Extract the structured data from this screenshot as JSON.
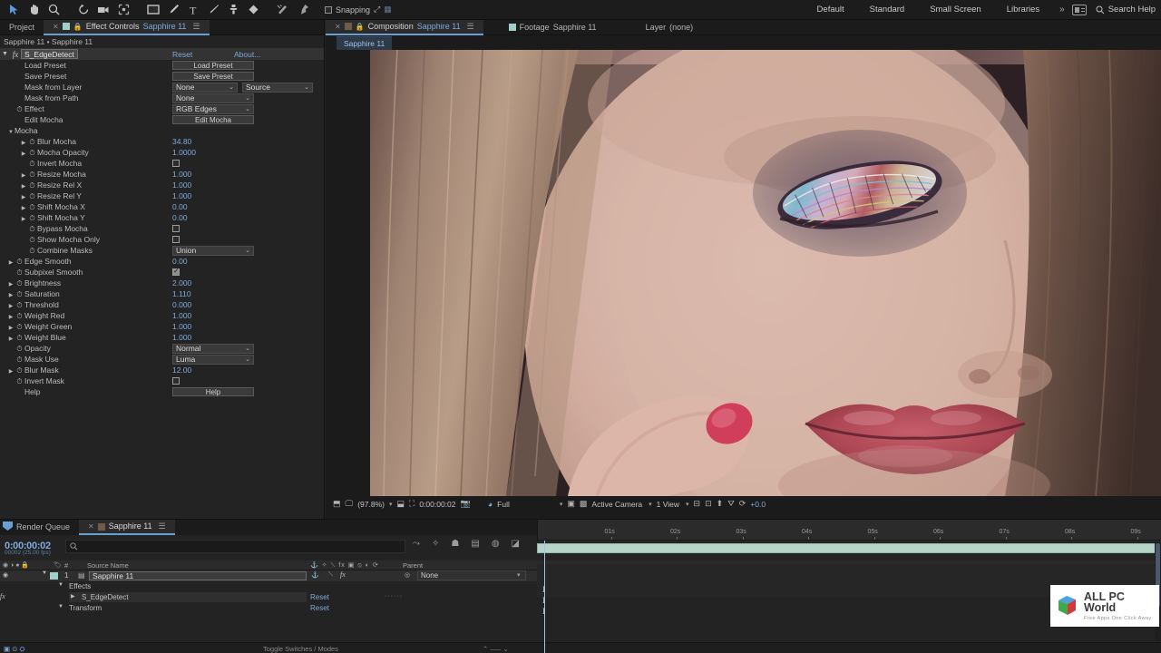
{
  "toolbar": {
    "tools": [
      {
        "name": "selection-tool",
        "glyph": "➤"
      },
      {
        "name": "hand-tool",
        "glyph": "✋"
      },
      {
        "name": "zoom-tool",
        "glyph": "🔍"
      },
      {
        "name": "rotation-tool",
        "glyph": "↺"
      },
      {
        "name": "camera-tool",
        "glyph": "🎥"
      },
      {
        "name": "pan-behind-tool",
        "glyph": "⛶"
      },
      {
        "name": "shape-tool",
        "glyph": "▭"
      },
      {
        "name": "pen-tool",
        "glyph": "✒"
      },
      {
        "name": "type-tool",
        "glyph": "T"
      },
      {
        "name": "brush-tool",
        "glyph": "✏"
      },
      {
        "name": "clone-stamp-tool",
        "glyph": "⚲"
      },
      {
        "name": "eraser-tool",
        "glyph": "◆"
      },
      {
        "name": "roto-brush-tool",
        "glyph": "⫽"
      },
      {
        "name": "puppet-pin-tool",
        "glyph": "📌"
      }
    ],
    "snapping_label": "Snapping",
    "workspaces": [
      "Default",
      "Standard",
      "Small Screen",
      "Libraries"
    ],
    "overflow_glyph": "»",
    "search_help": "Search Help"
  },
  "effect_controls": {
    "tab_project": "Project",
    "tab_title_prefix": "Effect Controls",
    "tab_title_item": "Sapphire 11",
    "breadcrumb": "Sapphire 11 • Sapphire 11",
    "effect_name": "S_EdgeDetect",
    "reset_label": "Reset",
    "about_label": "About...",
    "rows": [
      {
        "label": "Load Preset",
        "type": "button",
        "value": "Load Preset",
        "indent": 0
      },
      {
        "label": "Save Preset",
        "type": "button",
        "value": "Save Preset",
        "indent": 0
      },
      {
        "label": "Mask from Layer",
        "type": "dropdown2",
        "value": "None",
        "value2": "Source",
        "indent": 0
      },
      {
        "label": "Mask from Path",
        "type": "dropdown",
        "value": "None",
        "indent": 0
      },
      {
        "label": "Effect",
        "type": "dropdown",
        "value": "RGB Edges",
        "indent": 0,
        "stopwatch": true
      },
      {
        "label": "Edit Mocha",
        "type": "button",
        "value": "Edit Mocha",
        "indent": 0
      },
      {
        "label": "Mocha",
        "type": "group",
        "value": "",
        "indent": 0
      },
      {
        "label": "Blur Mocha",
        "type": "number",
        "value": "34.80",
        "indent": 1,
        "tri": true,
        "stopwatch": true
      },
      {
        "label": "Mocha Opacity",
        "type": "number",
        "value": "1.0000",
        "indent": 1,
        "tri": true,
        "stopwatch": true
      },
      {
        "label": "Invert Mocha",
        "type": "checkbox",
        "value": "off",
        "indent": 1,
        "stopwatch": true
      },
      {
        "label": "Resize Mocha",
        "type": "number",
        "value": "1.000",
        "indent": 1,
        "tri": true,
        "stopwatch": true
      },
      {
        "label": "Resize Rel X",
        "type": "number",
        "value": "1.000",
        "indent": 1,
        "tri": true,
        "stopwatch": true
      },
      {
        "label": "Resize Rel Y",
        "type": "number",
        "value": "1.000",
        "indent": 1,
        "tri": true,
        "stopwatch": true
      },
      {
        "label": "Shift Mocha X",
        "type": "number",
        "value": "0.00",
        "indent": 1,
        "tri": true,
        "stopwatch": true
      },
      {
        "label": "Shift Mocha Y",
        "type": "number",
        "value": "0.00",
        "indent": 1,
        "tri": true,
        "stopwatch": true
      },
      {
        "label": "Bypass Mocha",
        "type": "checkbox",
        "value": "off",
        "indent": 1,
        "stopwatch": true
      },
      {
        "label": "Show Mocha Only",
        "type": "checkbox",
        "value": "off",
        "indent": 1,
        "stopwatch": true
      },
      {
        "label": "Combine Masks",
        "type": "dropdown",
        "value": "Union",
        "indent": 1,
        "stopwatch": true
      },
      {
        "label": "Edge Smooth",
        "type": "number",
        "value": "0.00",
        "indent": 0,
        "tri": true,
        "stopwatch": true
      },
      {
        "label": "Subpixel Smooth",
        "type": "checkbox",
        "value": "on",
        "indent": 0,
        "stopwatch": true
      },
      {
        "label": "Brightness",
        "type": "number",
        "value": "2.000",
        "indent": 0,
        "tri": true,
        "stopwatch": true
      },
      {
        "label": "Saturation",
        "type": "number",
        "value": "1.110",
        "indent": 0,
        "tri": true,
        "stopwatch": true
      },
      {
        "label": "Threshold",
        "type": "number",
        "value": "0.000",
        "indent": 0,
        "tri": true,
        "stopwatch": true
      },
      {
        "label": "Weight Red",
        "type": "number",
        "value": "1.000",
        "indent": 0,
        "tri": true,
        "stopwatch": true
      },
      {
        "label": "Weight Green",
        "type": "number",
        "value": "1.000",
        "indent": 0,
        "tri": true,
        "stopwatch": true
      },
      {
        "label": "Weight Blue",
        "type": "number",
        "value": "1.000",
        "indent": 0,
        "tri": true,
        "stopwatch": true
      },
      {
        "label": "Opacity",
        "type": "dropdown",
        "value": "Normal",
        "indent": 0,
        "stopwatch": true
      },
      {
        "label": "Mask Use",
        "type": "dropdown",
        "value": "Luma",
        "indent": 0,
        "stopwatch": true
      },
      {
        "label": "Blur Mask",
        "type": "number",
        "value": "12.00",
        "indent": 0,
        "tri": true,
        "stopwatch": true
      },
      {
        "label": "Invert Mask",
        "type": "checkbox",
        "value": "off",
        "indent": 0,
        "stopwatch": true
      },
      {
        "label": "Help",
        "type": "button",
        "value": "Help",
        "indent": 0
      }
    ]
  },
  "composition": {
    "tabs": [
      {
        "prefix": "Composition",
        "name": "Sapphire 11",
        "active": true
      },
      {
        "prefix": "Footage",
        "name": "Sapphire 11",
        "active": false
      },
      {
        "prefix": "Layer",
        "name": "(none)",
        "active": false
      }
    ],
    "subtab": "Sapphire 11",
    "footer": {
      "zoom": "(97.8%)",
      "timecode": "0:00:00:02",
      "resolution": "Full",
      "camera": "Active Camera",
      "views": "1 View",
      "exposure": "+0.0"
    }
  },
  "timeline": {
    "tab_render_queue": "Render Queue",
    "tab_comp": "Sapphire 11",
    "timecode": "0:00:00:02",
    "frame_info": "00002 (25.00 fps)",
    "search_placeholder": "",
    "columns": {
      "source_name": "Source Name",
      "index": "#",
      "parent": "Parent"
    },
    "layers": [
      {
        "index": "1",
        "name": "Sapphire 11",
        "parent": "None"
      }
    ],
    "tree": [
      {
        "label": "Effects",
        "indent": 1,
        "reset": ""
      },
      {
        "label": "S_EdgeDetect",
        "indent": 2,
        "reset": "Reset"
      },
      {
        "label": "Transform",
        "indent": 1,
        "reset": "Reset"
      }
    ],
    "ruler_ticks": [
      "01s",
      "02s",
      "03s",
      "04s",
      "05s",
      "06s",
      "07s",
      "08s",
      "09s"
    ],
    "footer_label": "Toggle Switches / Modes"
  },
  "watermark": {
    "title": "ALL PC World",
    "tagline": "Free Apps One Click Away"
  },
  "colors": {
    "accent_blue": "#7fa9dd",
    "panel_bg": "#232323",
    "tab_bg": "#1b1b1b",
    "green_bar": "#b6d4c8"
  }
}
